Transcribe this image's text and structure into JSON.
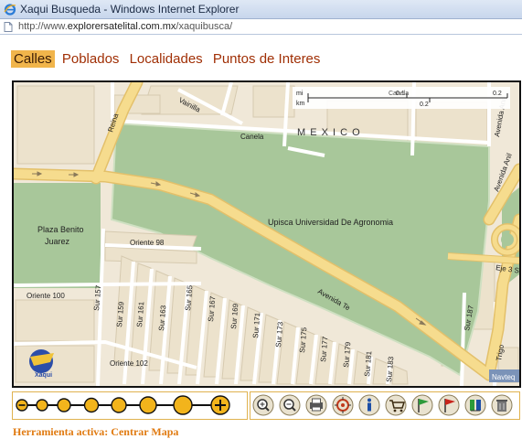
{
  "window": {
    "title": "Xaqui Busqueda - Windows Internet Explorer"
  },
  "address": {
    "prefix": "http://www.",
    "host": "explorersatelital.com.mx",
    "path": "/xaquibusca/"
  },
  "tabs": [
    {
      "label": "Calles",
      "active": true
    },
    {
      "label": "Poblados",
      "active": false
    },
    {
      "label": "Localidades",
      "active": false
    },
    {
      "label": "Puntos de Interes",
      "active": false
    }
  ],
  "map": {
    "country": "M E X I C O",
    "park_label": "Upisca Universidad De Agronomia",
    "plaza_label_1": "Plaza Benito",
    "plaza_label_2": "Juarez",
    "scale": {
      "unit_top": "mi",
      "unit_bottom": "km",
      "value_top_a": "0.1",
      "value_top_b": "0.2",
      "value_bottom": "0.2"
    },
    "streets": {
      "vainilla": "Vainilla",
      "reina": "Reina",
      "canela_top": "Canela",
      "canela": "Canela",
      "oriente98": "Oriente 98",
      "oriente100": "Oriente 100",
      "oriente102": "Oriente 102",
      "avenida_te": "Avenida Te",
      "avenida_anil": "Avenida Anil",
      "avenida_anil2": "Avenida Anil",
      "eje3": "Eje 3 S",
      "trigo": "Trigo",
      "sur157": "Sur 157",
      "sur159": "Sur 159",
      "sur161": "Sur 161",
      "sur163": "Sur 163",
      "sur165": "Sur 165",
      "sur167": "Sur 167",
      "sur169": "Sur 169",
      "sur171": "Sur 171",
      "sur173": "Sur 173",
      "sur175": "Sur 175",
      "sur177": "Sur 177",
      "sur179": "Sur 179",
      "sur181": "Sur 181",
      "sur183": "Sur 183",
      "sur187": "Sur 187"
    },
    "attribution": "Navteq",
    "logo_text": "Xaqui"
  },
  "zoom": {
    "levels": 8,
    "current_level": 8
  },
  "tools": [
    "zoom-in-icon",
    "zoom-out-icon",
    "print-icon",
    "center-map-icon",
    "info-icon",
    "cart-icon",
    "green-flag-icon",
    "red-flag-icon",
    "route-icon",
    "delete-icon"
  ],
  "status": {
    "text": "Herramienta activa: Centrar Mapa"
  },
  "colors": {
    "tab_active": "#f1b54b",
    "tab_text": "#a02f05",
    "park": "#a8c79a",
    "road": "#f6dc8e",
    "status": "#e07a10"
  }
}
